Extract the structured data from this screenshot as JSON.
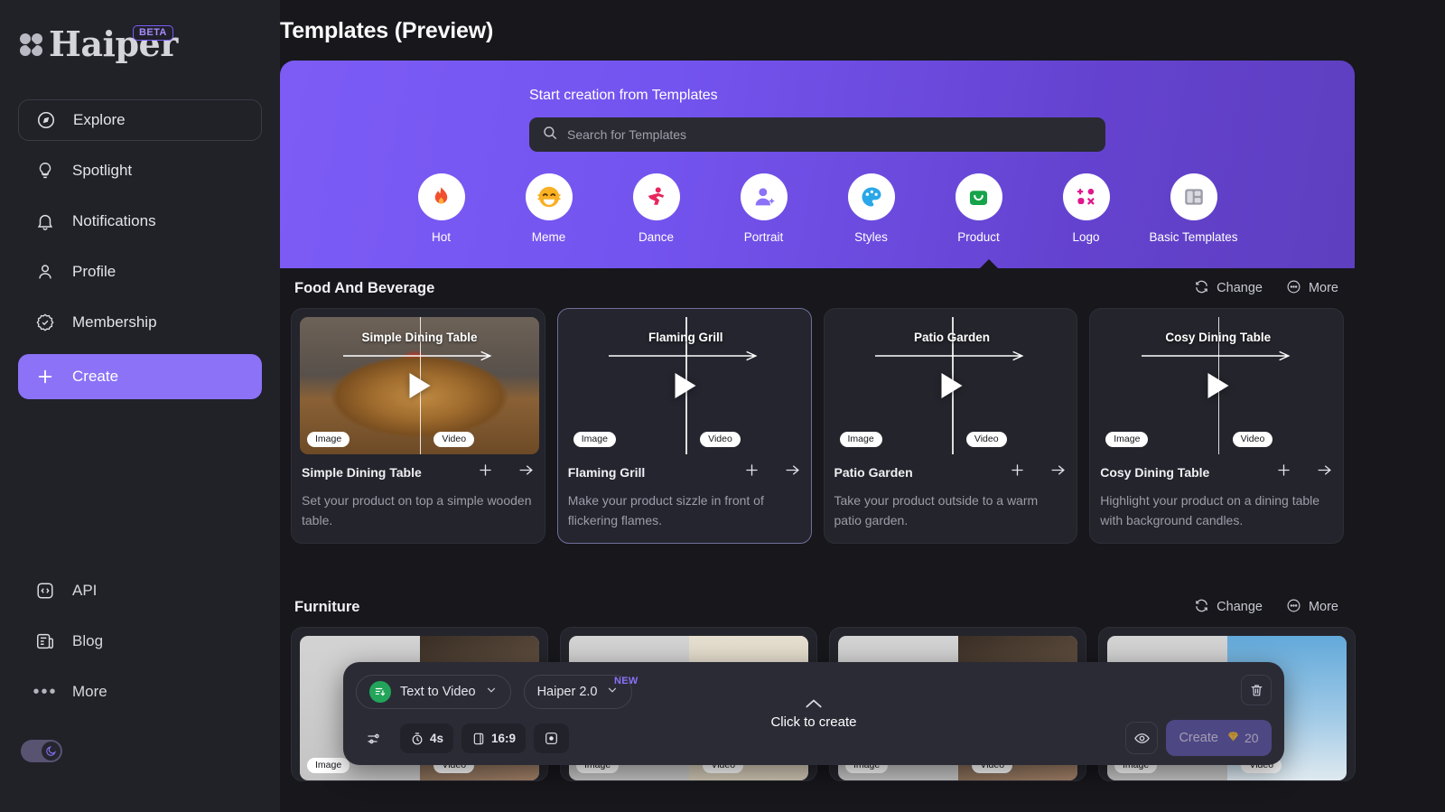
{
  "app": {
    "brand": "Haiper",
    "brand_badge": "BETA",
    "page_title": "Templates (Preview)"
  },
  "sidebar": {
    "items": [
      {
        "label": "Explore",
        "icon": "compass-icon",
        "active": true
      },
      {
        "label": "Spotlight",
        "icon": "lightbulb-icon",
        "active": false
      },
      {
        "label": "Notifications",
        "icon": "bell-icon",
        "active": false
      },
      {
        "label": "Profile",
        "icon": "user-icon",
        "active": false
      },
      {
        "label": "Membership",
        "icon": "badge-check-icon",
        "active": false
      }
    ],
    "create_label": "Create",
    "bottom_items": [
      {
        "label": "API",
        "icon": "code-icon"
      },
      {
        "label": "Blog",
        "icon": "newspaper-icon"
      },
      {
        "label": "More",
        "icon": "ellipsis-icon"
      }
    ],
    "theme_toggle": {
      "state": "dark",
      "icon": "moon-icon"
    }
  },
  "banner": {
    "title": "Start creation from Templates",
    "accent_from": "#7c5cf5",
    "accent_to": "#5e3fbf",
    "search": {
      "placeholder": "Search for Templates",
      "value": "",
      "icon": "search-icon"
    },
    "categories": [
      {
        "label": "Hot",
        "icon": "flame-icon",
        "selected": false
      },
      {
        "label": "Meme",
        "icon": "laughing-face-icon",
        "selected": false
      },
      {
        "label": "Dance",
        "icon": "dancing-person-icon",
        "selected": false
      },
      {
        "label": "Portrait",
        "icon": "portrait-icon",
        "selected": false
      },
      {
        "label": "Styles",
        "icon": "palette-icon",
        "selected": false
      },
      {
        "label": "Product",
        "icon": "shopping-bag-icon",
        "selected": true
      },
      {
        "label": "Logo",
        "icon": "logo-shapes-icon",
        "selected": false
      },
      {
        "label": "Basic Templates",
        "icon": "layout-panels-icon",
        "selected": false
      }
    ]
  },
  "sections": [
    {
      "title": "Food And Beverage",
      "change_label": "Change",
      "more_label": "More",
      "cards": [
        {
          "title": "Simple Dining Table",
          "overlay_title": "Simple Dining Table",
          "description": "Set your product on top a simple wooden table.",
          "left_tag": "Image",
          "right_tag": "Video",
          "selected": false
        },
        {
          "title": "Flaming Grill",
          "overlay_title": "Flaming Grill",
          "description": "Make your product sizzle in front of flickering flames.",
          "left_tag": "Image",
          "right_tag": "Video",
          "selected": true
        },
        {
          "title": "Patio Garden",
          "overlay_title": "Patio Garden",
          "description": "Take your product outside to a warm patio garden.",
          "left_tag": "Image",
          "right_tag": "Video",
          "selected": false
        },
        {
          "title": "Cosy Dining Table",
          "overlay_title": "Cosy Dining Table",
          "description": "Highlight your product on a dining table with background candles.",
          "left_tag": "Image",
          "right_tag": "Video",
          "selected": false
        }
      ]
    },
    {
      "title": "Furniture",
      "change_label": "Change",
      "more_label": "More",
      "cards": [
        {
          "left_tag": "Image",
          "right_tag": "Video"
        },
        {
          "left_tag": "Image",
          "right_tag": "Video"
        },
        {
          "left_tag": "Image",
          "right_tag": "Video"
        },
        {
          "left_tag": "Image",
          "right_tag": "Video"
        }
      ]
    }
  ],
  "toolbar": {
    "mode_label": "Text to Video",
    "model_label": "Haiper 2.0",
    "model_badge": "NEW",
    "duration_label": "4s",
    "aspect_label": "16:9",
    "center_hint": "Click to create",
    "create_label": "Create",
    "credit_cost": "20",
    "icons": {
      "settings": "sliders-icon",
      "duration": "stopwatch-icon",
      "aspect": "aspect-ratio-icon",
      "frame": "frame-icon",
      "preview": "eye-icon",
      "delete": "trash-icon",
      "credit": "gem-icon",
      "chevron": "chevron-up-icon"
    }
  }
}
